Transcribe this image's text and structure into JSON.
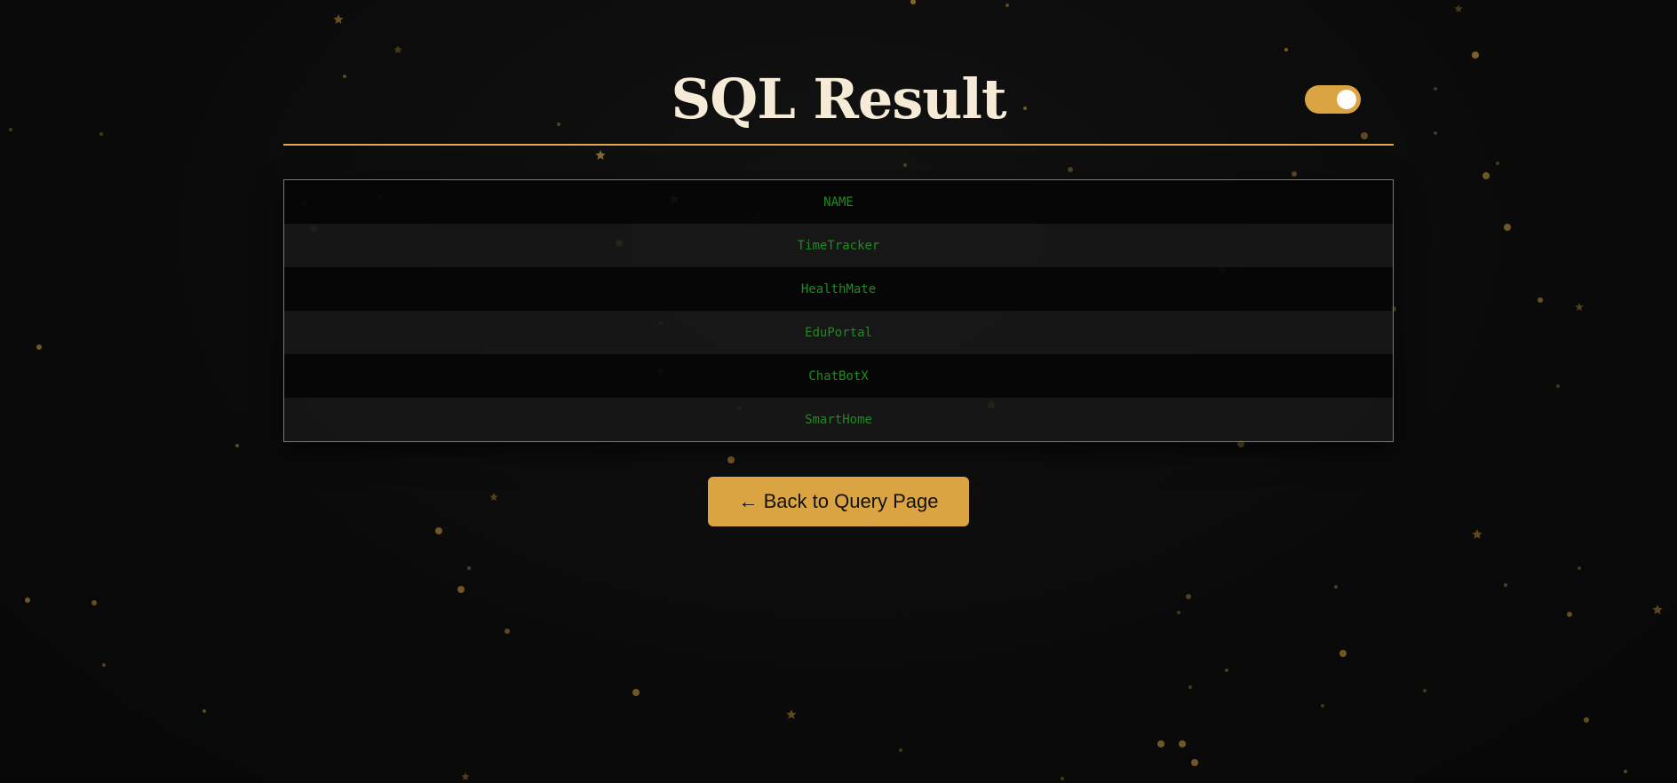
{
  "header": {
    "title": "SQL Result",
    "theme_toggle": {
      "state": "on"
    }
  },
  "table": {
    "columns": [
      "NAME"
    ],
    "rows": [
      [
        "TimeTracker"
      ],
      [
        "HealthMate"
      ],
      [
        "EduPortal"
      ],
      [
        "ChatBotX"
      ],
      [
        "SmartHome"
      ]
    ]
  },
  "actions": {
    "back_label": "← Back to Query Page"
  },
  "colors": {
    "accent": "#d9a441",
    "title": "#f5ebd6",
    "cell_text": "#1f8a1f",
    "background": "#0b0b0b"
  }
}
